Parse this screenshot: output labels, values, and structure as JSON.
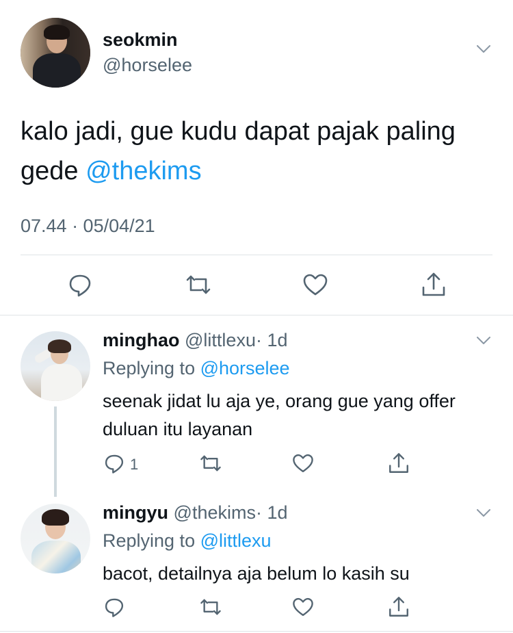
{
  "main_tweet": {
    "name": "seokmin",
    "handle": "@horselee",
    "text_before": "kalo jadi, gue kudu dapat pajak paling gede ",
    "mention": "@thekims",
    "timestamp": "07.44 · 05/04/21",
    "actions": [
      "reply-icon",
      "retweet-icon",
      "like-icon",
      "share-icon"
    ]
  },
  "replies": [
    {
      "name": "minghao",
      "handle": "@littlexu",
      "age": "· 1d",
      "replying_prefix": "Replying to ",
      "replying_to": "@horselee",
      "text": "seenak jidat lu aja ye, orang gue yang offer duluan itu layanan",
      "reply_count": "1"
    },
    {
      "name": "mingyu",
      "handle": "@thekims",
      "age": "· 1d",
      "replying_prefix": "Replying to ",
      "replying_to": "@littlexu",
      "text": "bacot, detailnya aja belum lo kasih su",
      "reply_count": ""
    }
  ],
  "colors": {
    "accent": "#1d9bf0",
    "secondary_text": "#536471",
    "primary_text": "#0f1419",
    "divider": "#dfe3e6"
  }
}
